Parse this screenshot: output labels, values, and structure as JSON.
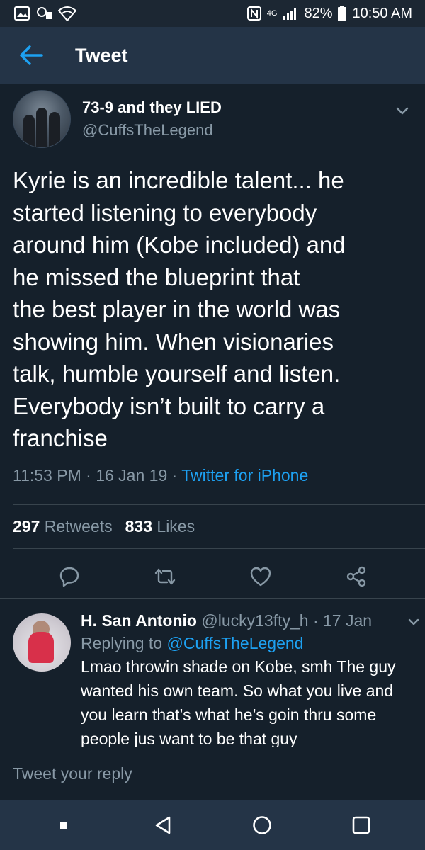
{
  "status_bar": {
    "battery": "82%",
    "time": "10:50 AM",
    "network": "4G"
  },
  "header": {
    "title": "Tweet"
  },
  "tweet": {
    "display_name": "73-9 and they LIED",
    "handle": "@CuffsTheLegend",
    "text": "Kyrie is an incredible talent... he\nstarted listening to everybody\naround him (Kobe included) and\nhe missed the blueprint that\nthe best player in the world was\nshowing him. When visionaries\ntalk, humble yourself and listen.\nEverybody isn’t built to carry a\nfranchise",
    "time": "11:53 PM",
    "date": "16 Jan 19",
    "source": "Twitter for iPhone",
    "retweets_count": "297",
    "retweets_label": "Retweets",
    "likes_count": "833",
    "likes_label": "Likes"
  },
  "reply": {
    "display_name": "H. San Antonio",
    "handle": "@lucky13fty_h",
    "date": "17 Jan",
    "replying_label": "Replying to",
    "replying_to": "@CuffsTheLegend",
    "text": "Lmao throwin shade on Kobe, smh The guy wanted his own team. So what you live and you learn that’s what he’s goin thru some people jus want to be that guy"
  },
  "composer": {
    "placeholder": "Tweet your reply"
  },
  "colors": {
    "background": "#15202b",
    "header": "#243447",
    "accent": "#1da1f2",
    "muted": "#8899a6"
  }
}
